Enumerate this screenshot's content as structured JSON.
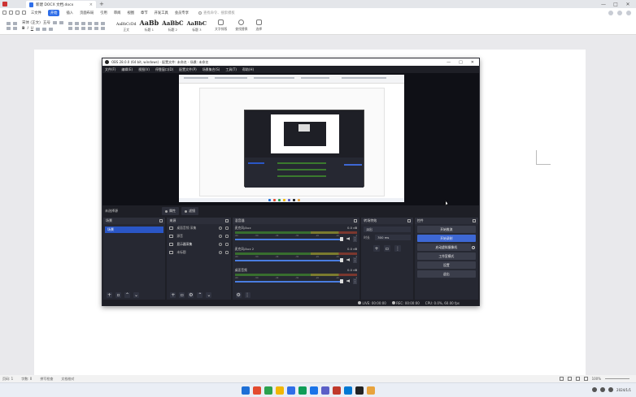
{
  "titlebar": {
    "tab_title": "新建 DOCX 文档.docx",
    "close_glyph": "×",
    "new_tab_glyph": "+",
    "window_buttons": [
      "—",
      "□",
      "✕"
    ]
  },
  "menubar": {
    "items": [
      "三文件",
      "开始",
      "插入",
      "页面布局",
      "引用",
      "审阅",
      "视图",
      "章节",
      "开发工具",
      "会员专享"
    ],
    "active_index": 1,
    "search_placeholder": "查找命令、搜索模板"
  },
  "ribbon": {
    "font_name": "宋体 (正文)",
    "font_size": "五号",
    "styles": [
      {
        "preview": "AaBbCcDd",
        "label": "正文",
        "size": 4.5
      },
      {
        "preview": "AaBb",
        "label": "标题 1",
        "size": 8
      },
      {
        "preview": "AaBbC",
        "label": "标题 2",
        "size": 7
      },
      {
        "preview": "AaBbC",
        "label": "标题 3",
        "size": 6.5
      }
    ],
    "tools": [
      "文字排版",
      "查找替换",
      "选择"
    ]
  },
  "obs": {
    "title": "OBS 28.0.0 (64 bit, windows) - 配置文件: 未命名 - 场景: 未命名",
    "window_buttons": [
      "—",
      "□",
      "✕"
    ],
    "menu": [
      "文件(F)",
      "编辑(E)",
      "视图(V)",
      "停靠窗口(D)",
      "配置文件(P)",
      "场景集合(S)",
      "工具(T)",
      "帮助(H)"
    ],
    "scene_bar": {
      "label": "未选择源",
      "properties": "属性",
      "filters": "滤镜"
    },
    "scenes": {
      "title": "场景",
      "items": [
        "场景"
      ]
    },
    "sources": {
      "title": "来源",
      "items": [
        "桌面音频 采集",
        "源音",
        "显示器采集",
        "未标题"
      ]
    },
    "mixer": {
      "title": "混音器",
      "channels": [
        {
          "name": "麦克风/Aux",
          "db": "0.0 dB"
        },
        {
          "name": "麦克风/Aux 2",
          "db": "0.0 dB"
        },
        {
          "name": "桌面音频",
          "db": "0.0 dB"
        }
      ],
      "ticks": [
        "-60",
        "-55",
        "-50",
        "-45",
        "-40",
        "-35",
        "-30",
        "-25",
        "-20",
        "-15",
        "-10",
        "-5",
        "0"
      ]
    },
    "transitions": {
      "title": "转场特效",
      "type": "淡出",
      "duration_label": "时长",
      "duration": "300 ms"
    },
    "controls": {
      "title": "控件",
      "buttons": [
        "开始推流",
        "开始录制",
        "启动虚拟摄像机",
        "工作室模式",
        "设置",
        "退出"
      ],
      "active_index": 1
    },
    "status": {
      "live": "LIVE: 00:00:00",
      "rec": "REC: 00:00:00",
      "cpu": "CPU: 0.0%, 60.00 fps"
    }
  },
  "wps_status": {
    "left": [
      "页码: 1",
      "字数: 0",
      "拼写检查",
      "文档校对"
    ],
    "zoom": "100%"
  },
  "taskbar": {
    "icon_colors": [
      "#1e6fd6",
      "#e34b2f",
      "#2ca24f",
      "#f2b705",
      "#2f6ee8",
      "#0f9d58",
      "#1a73e8",
      "#5b5fc7",
      "#c0392b",
      "#0078d4",
      "#222222",
      "#e8a33d"
    ],
    "clock": "2024/1/1"
  }
}
